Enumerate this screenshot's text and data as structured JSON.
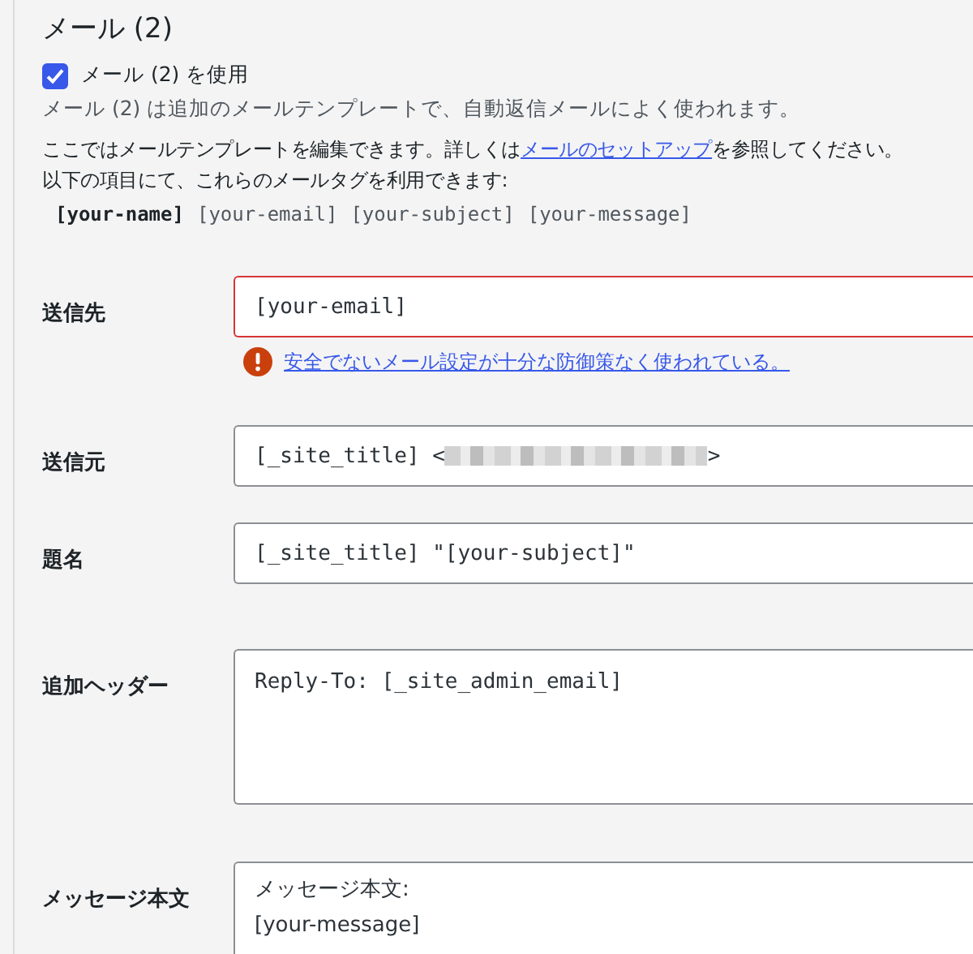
{
  "section": {
    "title": "メール (2)",
    "use_checkbox": {
      "label": "メール (2) を使用",
      "checked": true
    },
    "description": "メール (2) は追加のメールテンプレートで、自動返信メールによく使われます。",
    "help_before": "ここではメールテンプレートを編集できます。詳しくは",
    "help_link": "メールのセットアップ",
    "help_after": "を参照してください。",
    "help_line2": "以下の項目にて、これらのメールタグを利用できます:",
    "mail_tags": [
      {
        "text": "[your-name]",
        "bold": true
      },
      {
        "text": "[your-email]",
        "bold": false
      },
      {
        "text": "[your-subject]",
        "bold": false
      },
      {
        "text": "[your-message]",
        "bold": false
      }
    ]
  },
  "fields": [
    {
      "kind": "input",
      "label": "送信先",
      "value": "[your-email]",
      "invalid": true,
      "error": "安全でないメール設定が十分な防御策なく使われている。"
    },
    {
      "kind": "redacted",
      "label": "送信元",
      "value_before": "[_site_title] <",
      "value_after": ">",
      "invalid": false
    },
    {
      "kind": "input",
      "label": "題名",
      "value": "[_site_title] \"[your-subject]\"",
      "invalid": false
    },
    {
      "kind": "textarea",
      "label": "追加ヘッダー",
      "value": "Reply-To: [_site_admin_email]",
      "invalid": false
    },
    {
      "kind": "textarea_tall",
      "label": "メッセージ本文",
      "value": "メッセージ本文:\n[your-message]",
      "invalid": false
    }
  ]
}
